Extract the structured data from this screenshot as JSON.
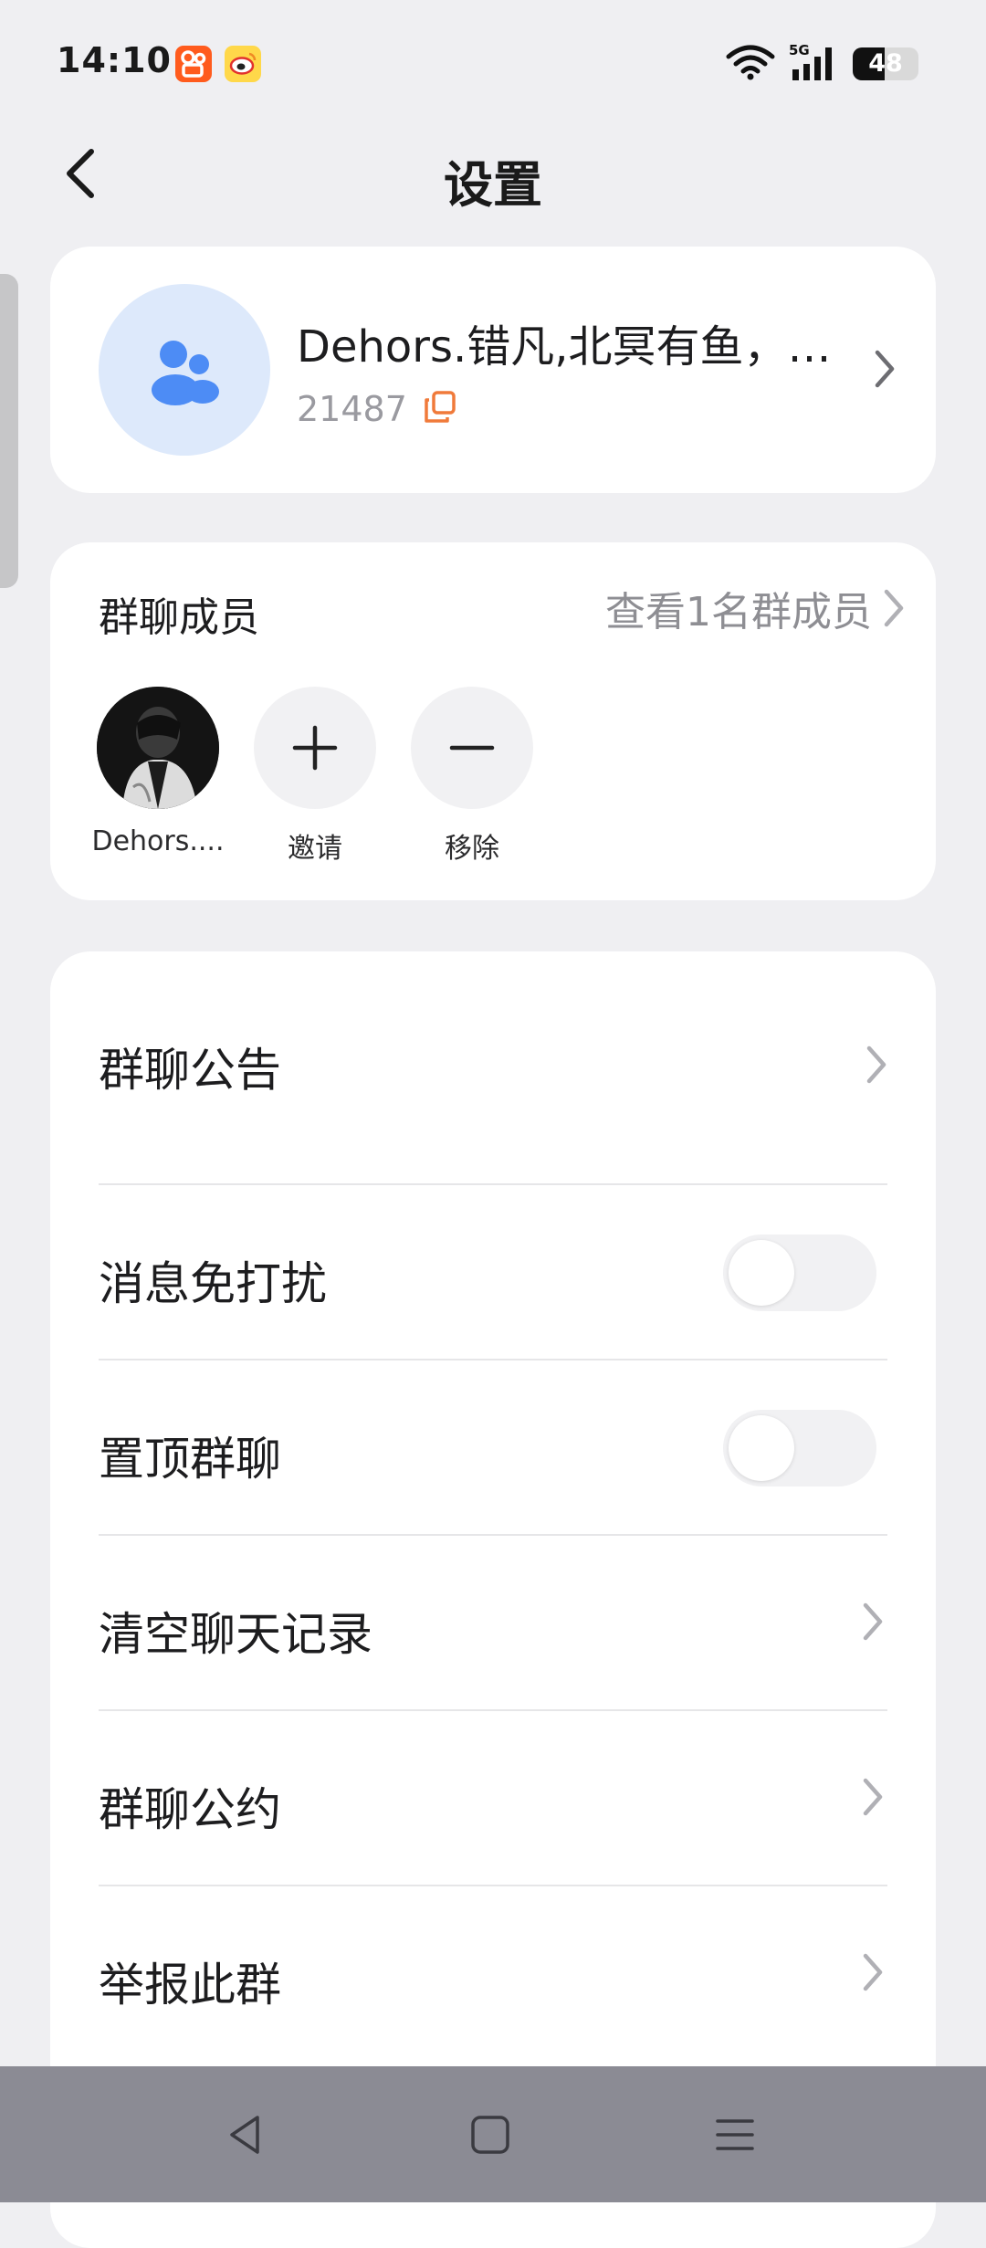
{
  "status_bar": {
    "time": "14:10",
    "apps": [
      "kuaishou-icon",
      "weibo-icon"
    ],
    "network": "5G",
    "battery_level": "48",
    "battery_fraction": 0.48
  },
  "header": {
    "title": "设置"
  },
  "group": {
    "name": "Dehors.错凡,北冥有鱼，…",
    "id": "21487"
  },
  "members": {
    "title": "群聊成员",
    "view_all": "查看1名群成员",
    "list": [
      {
        "label": "Dehors...."
      },
      {
        "label": "邀请"
      },
      {
        "label": "移除"
      }
    ]
  },
  "settings": [
    {
      "label": "群聊公告",
      "type": "link"
    },
    {
      "label": "消息免打扰",
      "type": "toggle",
      "on": false
    },
    {
      "label": "置顶群聊",
      "type": "toggle",
      "on": false
    },
    {
      "label": "清空聊天记录",
      "type": "link"
    },
    {
      "label": "群聊公约",
      "type": "link"
    },
    {
      "label": "举报此群",
      "type": "link"
    }
  ],
  "colors": {
    "background": "#efeff2",
    "card": "#ffffff",
    "accent_blue": "#4d8cf5",
    "copy_orange": "#f07a3a",
    "nav_bar": "#8b8b94"
  }
}
